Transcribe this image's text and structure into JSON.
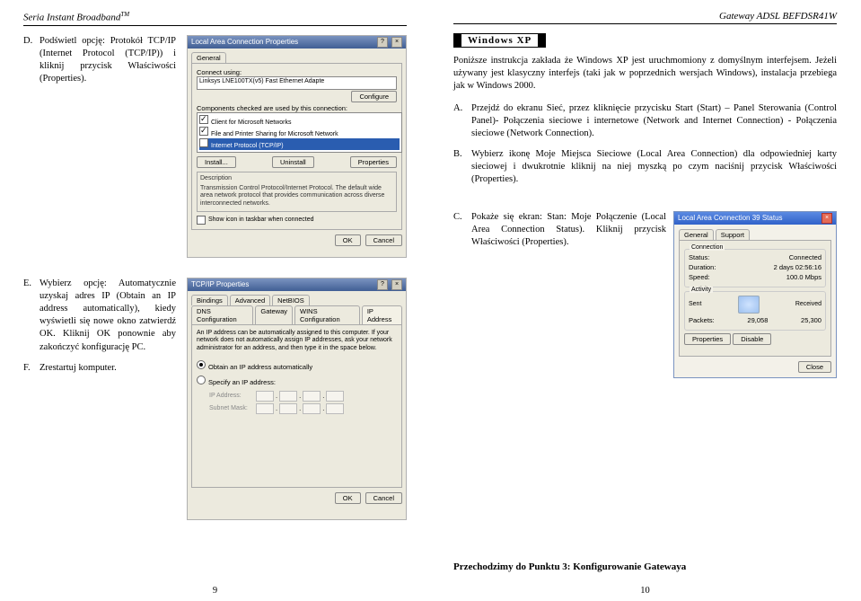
{
  "header": {
    "left": "Seria Instant Broadband",
    "left_sup": "TM",
    "right": "Gateway ADSL BEFDSR41W"
  },
  "left": {
    "itemD": {
      "marker": "D.",
      "text": "Podświetl opcję: Protokół TCP/IP (Internet Protocol (TCP/IP)) i kliknij przycisk Właściwości (Properties)."
    },
    "itemE": {
      "marker": "E.",
      "text": "Wybierz opcję: Automatycznie uzyskaj adres IP (Obtain an IP address automatically), kiedy wyświetli się nowe okno zatwierdź OK. Kliknij OK ponownie aby zakończyć konfigurację PC."
    },
    "itemF": {
      "marker": "F.",
      "text": "Zrestartuj komputer."
    },
    "lacp": {
      "title": "Local Area Connection Properties",
      "tab": "General",
      "connect_using": "Connect using:",
      "adapter": "Linksys LNE100TX(v5) Fast Ethernet Adapte",
      "components_lbl": "Components checked are used by this connection:",
      "comp1": "Client for Microsoft Networks",
      "comp2": "File and Printer Sharing for Microsoft Network",
      "comp3": "Internet Protocol (TCP/IP)",
      "install": "Install...",
      "uninstall": "Uninstall",
      "properties": "Properties",
      "desc_lbl": "Description",
      "desc_txt": "Transmission Control Protocol/Internet Protocol. The default wide area network protocol that provides communication across diverse interconnected networks.",
      "show_icon": "Show icon in taskbar when connected",
      "ok": "OK",
      "cancel": "Cancel"
    },
    "ipprops": {
      "title": "TCP/IP Properties",
      "tabs": {
        "a": "Bindings",
        "b": "Advanced",
        "c": "NetBIOS",
        "d": "DNS Configuration",
        "e": "Gateway",
        "f": "WINS Configuration",
        "g": "IP Address"
      },
      "blurb": "An IP address can be automatically assigned to this computer. If your network does not automatically assign IP addresses, ask your network administrator for an address, and then type it in the space below.",
      "optA": "Obtain an IP address automatically",
      "optB": "Specify an IP address:",
      "ip_lbl": "IP Address:",
      "sm_lbl": "Subnet Mask:",
      "ok": "OK",
      "cancel": "Cancel"
    },
    "page_num": "9"
  },
  "right": {
    "xp_title": "Windows XP",
    "intro": "Poniższe instrukcja zakłada że Windows XP jest uruchmomiony z domyślnym interfejsem. Jeżeli używany jest klasyczny interfejs (taki jak w poprzednich wersjach Windows), instalacja przebiega jak w Windows 2000.",
    "itemA": {
      "marker": "A.",
      "text": "Przejdź do ekranu Sieć, przez kliknięcie przycisku Start (Start) – Panel Sterowania (Control Panel)- Połączenia sieciowe i internetowe (Network and Internet Connection) - Połączenia sieciowe (Network Connection)."
    },
    "itemB": {
      "marker": "B.",
      "text": "Wybierz ikonę Moje Miejsca Sieciowe (Local Area Connection) dla odpowiedniej karty sieciowej i dwukrotnie kliknij na niej myszką po czym naciśnij przycisk Właściwości (Properties)."
    },
    "itemC": {
      "marker": "C.",
      "text": "Pokaże się ekran: Stan: Moje Połączenie (Local Area Connection Status). Kliknij przycisk Właściwości (Properties)."
    },
    "status": {
      "title": "Local Area Connection 39 Status",
      "tab1": "General",
      "tab2": "Support",
      "conn_lbl": "Connection",
      "stat_lbl": "Status:",
      "stat_val": "Connected",
      "dur_lbl": "Duration:",
      "dur_val": "2 days 02:56:16",
      "spd_lbl": "Speed:",
      "spd_val": "100.0 Mbps",
      "act_lbl": "Activity",
      "sent": "Sent",
      "recv": "Received",
      "pkts": "Packets:",
      "sent_val": "29,058",
      "recv_val": "25,300",
      "props": "Properties",
      "disable": "Disable",
      "close": "Close"
    },
    "footer": "Przechodzimy do Punktu 3: Konfigurowanie Gatewaya",
    "page_num": "10"
  }
}
